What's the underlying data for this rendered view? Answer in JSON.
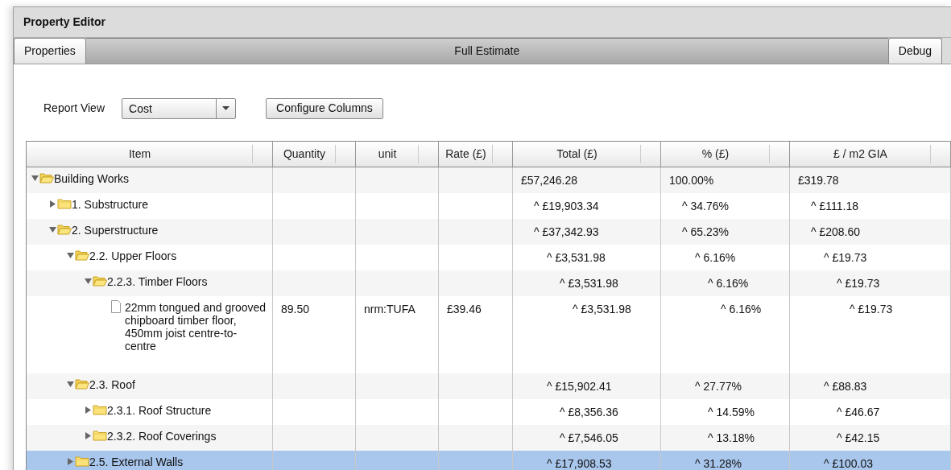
{
  "window": {
    "title": "Property Editor"
  },
  "tabs": [
    {
      "label": "Properties",
      "selected": false
    },
    {
      "label": "Full Estimate",
      "selected": true
    },
    {
      "label": "Debug",
      "selected": false
    }
  ],
  "report_view": {
    "label": "Report View",
    "value": "Cost"
  },
  "configure_button": "Configure Columns",
  "table": {
    "columns": [
      "Item",
      "Quantity",
      "unit",
      "Rate (£)",
      "Total (£)",
      "% (£)",
      "£ / m2 GIA"
    ],
    "rows": [
      {
        "kind": "folder",
        "item": "Building Works",
        "expanded": true,
        "selected": false,
        "total": "£57,246.28",
        "percent": "100.00%",
        "per_m2": "£319.78",
        "children": [
          {
            "kind": "folder",
            "item": "1. Substructure",
            "expanded": false,
            "selected": false,
            "total": "^ £19,903.34",
            "percent": "^ 34.76%",
            "per_m2": "^ £111.18"
          },
          {
            "kind": "folder",
            "item": "2. Superstructure",
            "expanded": true,
            "selected": false,
            "total": "^ £37,342.93",
            "percent": "^ 65.23%",
            "per_m2": "^ £208.60",
            "children": [
              {
                "kind": "folder",
                "item": "2.2. Upper Floors",
                "expanded": true,
                "selected": false,
                "total": "^ £3,531.98",
                "percent": "^ 6.16%",
                "per_m2": "^ £19.73",
                "children": [
                  {
                    "kind": "folder",
                    "item": "2.2.3. Timber Floors",
                    "expanded": true,
                    "selected": false,
                    "total": "^ £3,531.98",
                    "percent": "^ 6.16%",
                    "per_m2": "^ £19.73",
                    "children": [
                      {
                        "kind": "leaf",
                        "item": "22mm tongued and grooved chipboard timber floor, 450mm joist centre-to-centre",
                        "selected": false,
                        "quantity": "89.50",
                        "unit": "nrm:TUFA",
                        "rate": "£39.46",
                        "total": "^ £3,531.98",
                        "percent": "^ 6.16%",
                        "per_m2": "^ £19.73"
                      }
                    ]
                  }
                ]
              },
              {
                "kind": "folder",
                "item": "2.3. Roof",
                "expanded": true,
                "selected": false,
                "total": "^ £15,902.41",
                "percent": "^ 27.77%",
                "per_m2": "^ £88.83",
                "children": [
                  {
                    "kind": "folder",
                    "item": "2.3.1. Roof Structure",
                    "expanded": false,
                    "selected": false,
                    "total": "^ £8,356.36",
                    "percent": "^ 14.59%",
                    "per_m2": "^ £46.67"
                  },
                  {
                    "kind": "folder",
                    "item": "2.3.2. Roof Coverings",
                    "expanded": false,
                    "selected": false,
                    "total": "^ £7,546.05",
                    "percent": "^ 13.18%",
                    "per_m2": "^ £42.15"
                  }
                ]
              },
              {
                "kind": "folder",
                "item": "2.5. External Walls",
                "expanded": false,
                "selected": true,
                "total": "^ £17,908.53",
                "percent": "^ 31.28%",
                "per_m2": "^ £100.03"
              }
            ]
          }
        ]
      }
    ]
  }
}
